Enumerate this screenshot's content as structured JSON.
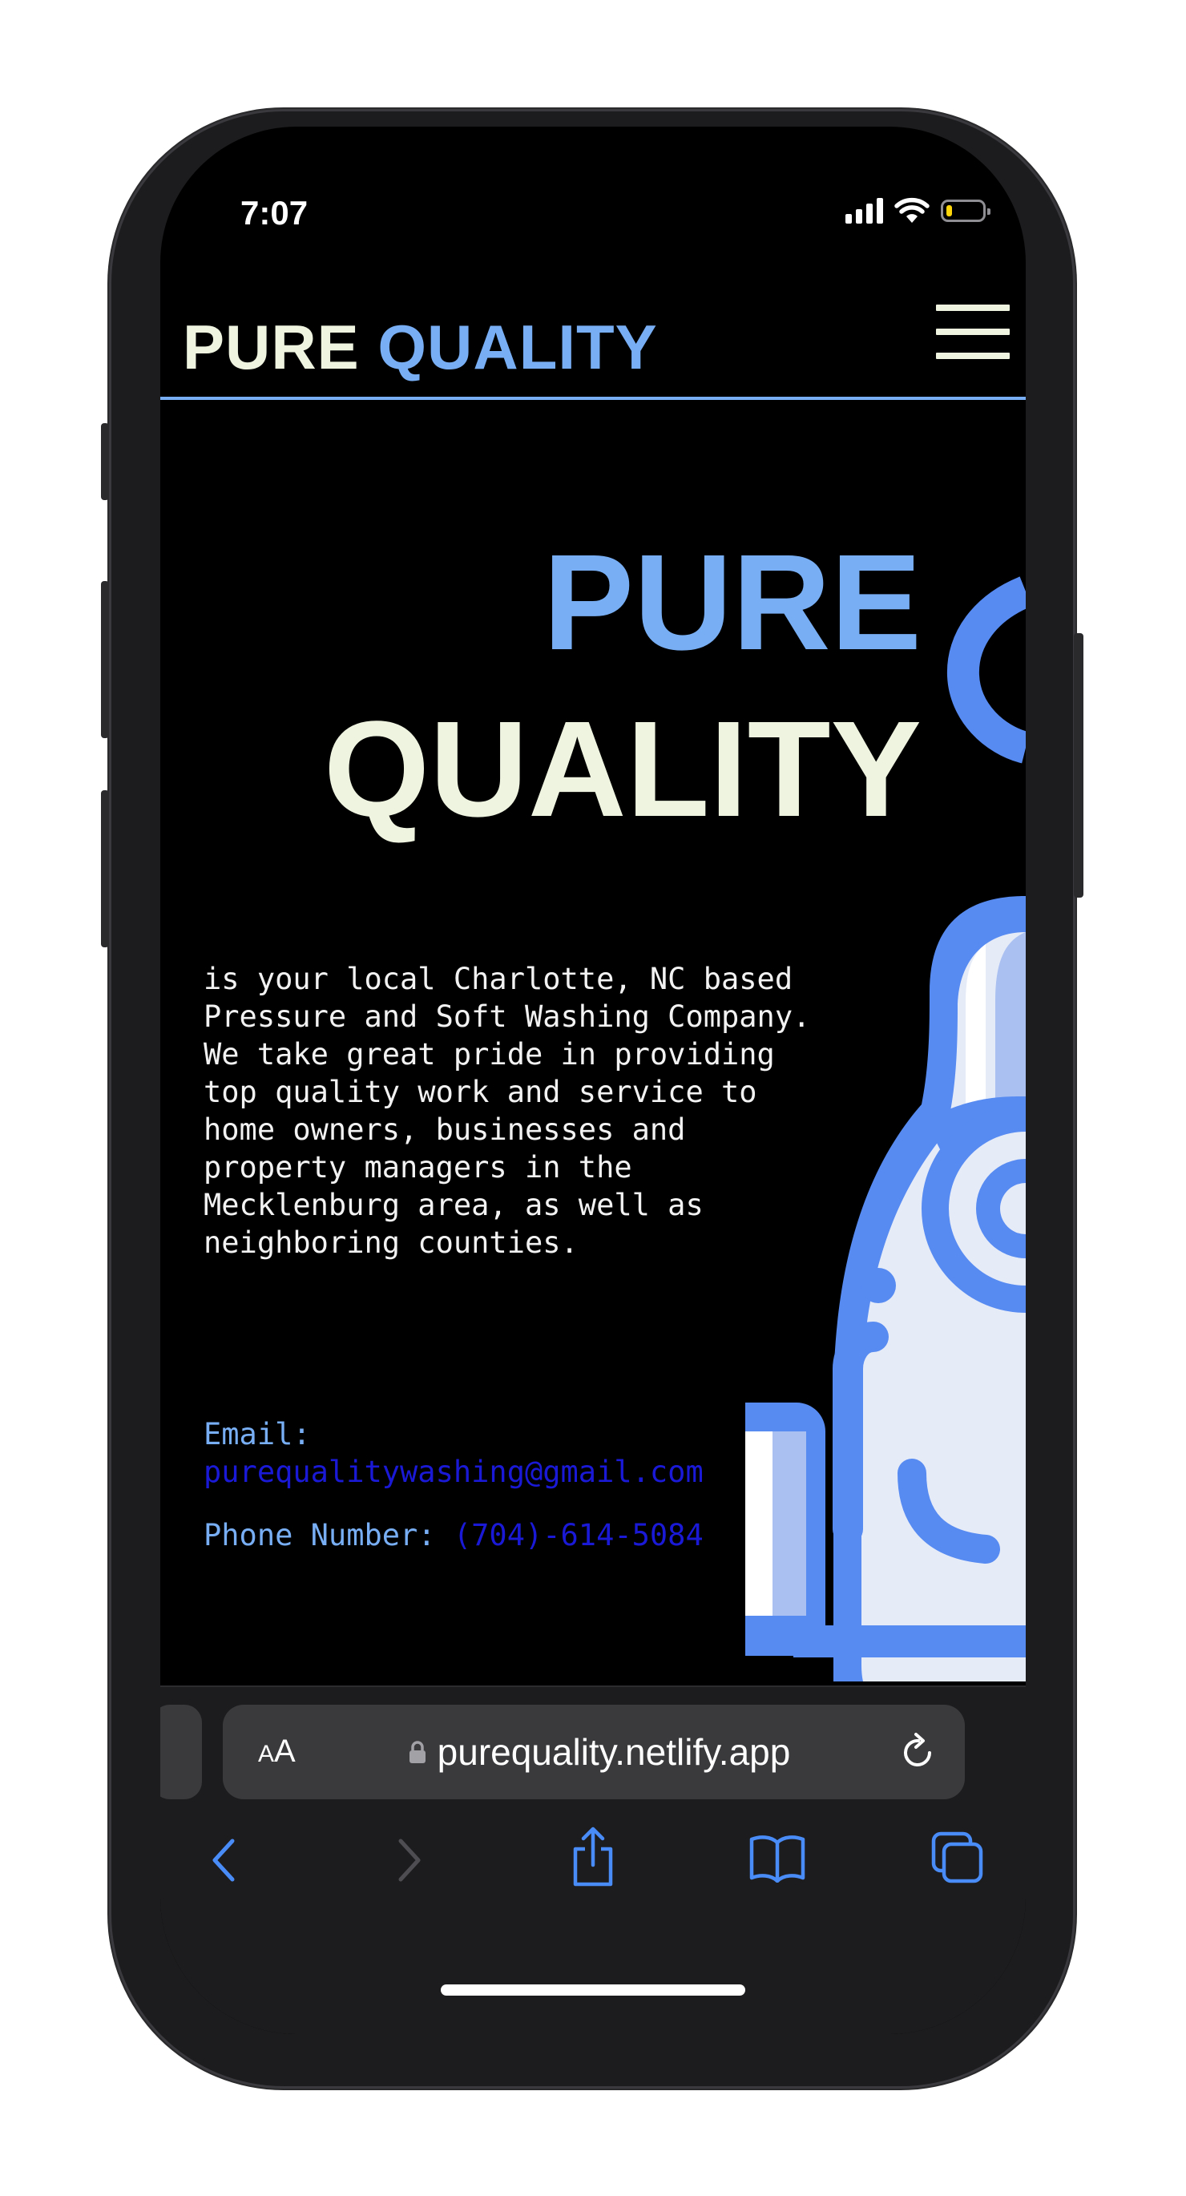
{
  "status_bar": {
    "time": "7:07",
    "icons": [
      "cellular-signal-icon",
      "wifi-icon",
      "battery-low-icon"
    ],
    "battery_color": "#ffd60a",
    "battery_level": 0.15
  },
  "site": {
    "logo_part1": "PURE ",
    "logo_part2": "QUALITY",
    "menu_icon": "hamburger-menu-icon",
    "hero_line1": "PURE",
    "hero_line2": "QUALITY",
    "description": "is your local Charlotte, NC based Pressure and Soft Washing Company. We take great pride in providing top quality work and service to home owners, businesses and property managers in the Mecklenburg area, as well as neighboring counties.",
    "email_label": "Email:",
    "email_value": "purequalitywashing@gmail.com",
    "phone_label": "Phone Number:",
    "phone_value": "(704)-614-5084",
    "colors": {
      "accent_blue": "#78aef3",
      "cream": "#eef4e0",
      "link": "#1a1ad6",
      "background": "#000000"
    }
  },
  "browser": {
    "text_size_label": "AA",
    "url": "purequality.netlify.app",
    "toolbar_icons": [
      "back-icon",
      "forward-icon",
      "share-icon",
      "bookmarks-icon",
      "tabs-icon"
    ]
  }
}
